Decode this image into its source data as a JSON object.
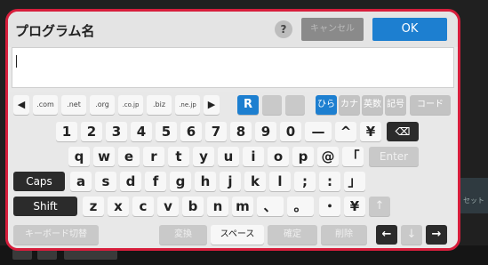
{
  "dialog": {
    "title": "プログラム名",
    "help_label": "?",
    "cancel_label": "キャンセル",
    "ok_label": "OK",
    "input_value": ""
  },
  "background": {
    "right_label": "セット"
  },
  "keyboard": {
    "row0": {
      "left_arrow": "◀",
      "domains": [
        ".com",
        ".net",
        ".org",
        ".co.jp",
        ".biz",
        ".ne.jp"
      ],
      "right_arrow": "▶",
      "r_label": "R",
      "modes": [
        "ひら",
        "カナ",
        "英数",
        "記号",
        "コード"
      ]
    },
    "row1": [
      "1",
      "2",
      "3",
      "4",
      "5",
      "6",
      "7",
      "8",
      "9",
      "0",
      "—",
      "^",
      "¥"
    ],
    "backspace": "⌫",
    "row2": [
      "q",
      "w",
      "e",
      "r",
      "t",
      "y",
      "u",
      "i",
      "o",
      "p",
      "@",
      "「"
    ],
    "enter_label": "Enter",
    "caps_label": "Caps",
    "row3": [
      "a",
      "s",
      "d",
      "f",
      "g",
      "h",
      "j",
      "k",
      "l",
      ";",
      ":",
      "」"
    ],
    "shift_label": "Shift",
    "row4": [
      "z",
      "x",
      "c",
      "v",
      "b",
      "n",
      "m",
      "、",
      "。",
      "・",
      "¥"
    ],
    "up_arrow": "↑",
    "switch_label": "キーボード切替",
    "convert_label": "変換",
    "space_label": "スペース",
    "confirm_label": "確定",
    "clear_label": "削除",
    "arrow_left": "←",
    "arrow_down": "↓",
    "arrow_right": "→"
  }
}
